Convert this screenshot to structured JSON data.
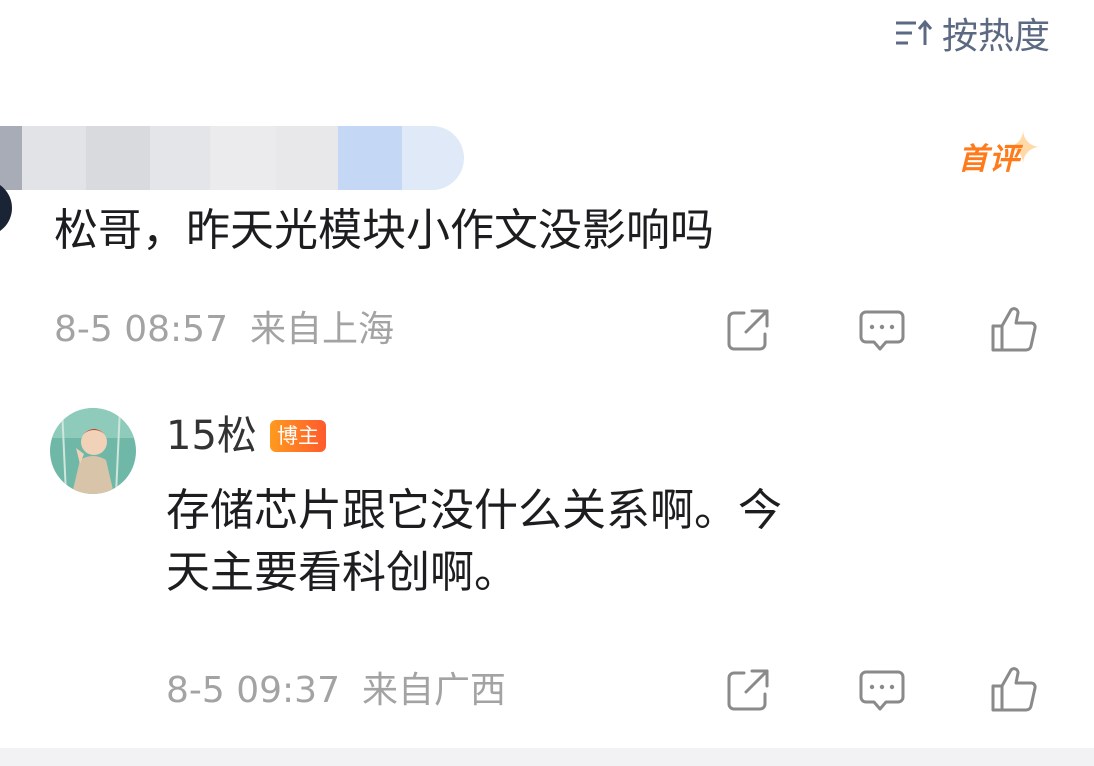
{
  "sort": {
    "label": "按热度",
    "icon": "sort-icon"
  },
  "comment": {
    "badge": "首评",
    "text": "松哥，昨天光模块小作文没影响吗",
    "date": "8-5 08:57",
    "location": "来自上海",
    "actions": [
      "share-icon",
      "comment-icon",
      "like-icon"
    ]
  },
  "reply": {
    "author": "15松",
    "author_badge": "博主",
    "line1": "存储芯片跟它没什么关系啊。今",
    "line2": "天主要看科创啊。",
    "date": "8-5 09:37",
    "location": "来自广西",
    "actions": [
      "share-icon",
      "comment-icon",
      "like-icon"
    ]
  },
  "colors": {
    "text": "#1d1d1f",
    "meta": "#a3a3a3",
    "sort": "#5b6a82",
    "badge_orange": "#ff7a1a"
  }
}
